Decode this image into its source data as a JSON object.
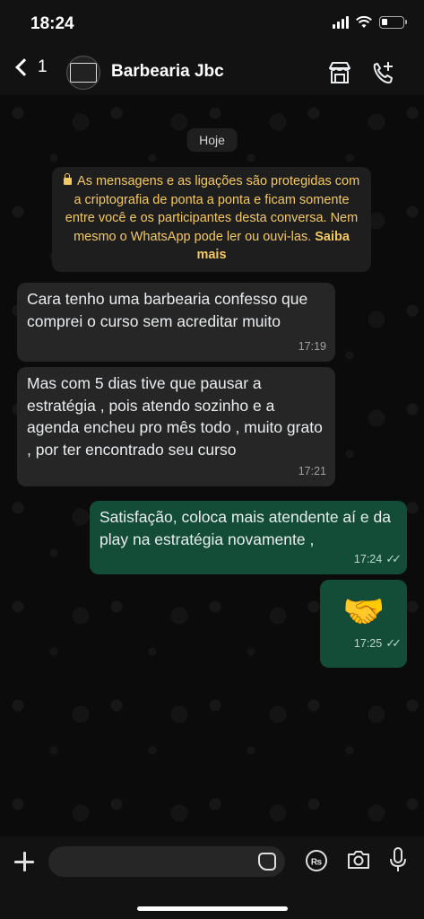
{
  "status_bar": {
    "time": "18:24"
  },
  "header": {
    "back_count": "1",
    "contact_name": "Barbearia Jbc",
    "avatar_text": "Barbearia Jbc"
  },
  "chat": {
    "date_chip": "Hoje",
    "encryption_notice": {
      "text": "As mensagens e as ligações são protegidas com a criptografia de ponta a ponta e ficam somente entre você e os participantes desta conversa. Nem mesmo o WhatsApp pode ler ou ouvi-las.",
      "link": "Saiba mais"
    },
    "messages": [
      {
        "direction": "incoming",
        "text": "Cara tenho uma barbearia confesso que comprei o curso sem acreditar muito",
        "time": "17:19"
      },
      {
        "direction": "incoming",
        "text": "Mas com 5 dias tive que pausar a estratégia , pois atendo sozinho e a agenda encheu pro mês todo , muito grato , por ter encontrado seu curso",
        "time": "17:21"
      },
      {
        "direction": "outgoing",
        "text": "Satisfação, coloca mais atendente aí e da play na estratégia novamente ,",
        "time": "17:24",
        "status": "read"
      },
      {
        "direction": "outgoing",
        "text": "🤝",
        "time": "17:25",
        "status": "read"
      }
    ]
  },
  "composer": {
    "placeholder": ""
  },
  "icons": {
    "back": "chevron-left-icon",
    "catalog": "storefront-icon",
    "call": "phone-plus-icon",
    "attach": "plus-icon",
    "sticker": "sticker-icon",
    "payment": "rupee-payment-icon",
    "camera": "camera-icon",
    "mic": "microphone-icon"
  },
  "colors": {
    "incoming_bubble": "#262626",
    "outgoing_bubble": "#144d37",
    "notice_text": "#f4c861"
  }
}
